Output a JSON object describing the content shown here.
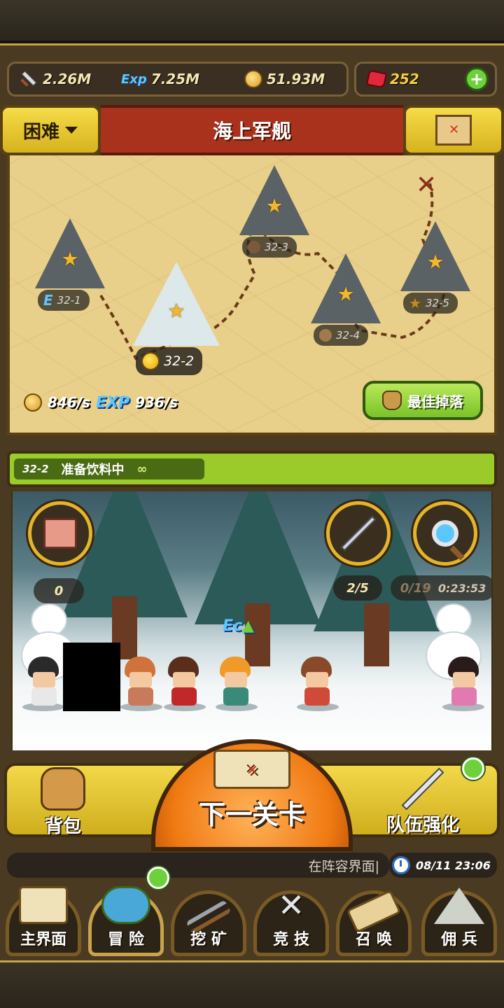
{
  "resources": {
    "attack": "2.26M",
    "exp_icon": "Exp",
    "exp": "7.25M",
    "gold": "51.93M",
    "gems": "252",
    "plus": "+"
  },
  "header": {
    "difficulty": "困难",
    "stage_name": "海上军舰"
  },
  "map": {
    "nodes": [
      {
        "id": "32-1",
        "badge": "E"
      },
      {
        "id": "32-2"
      },
      {
        "id": "32-3"
      },
      {
        "id": "32-4"
      },
      {
        "id": "32-5"
      }
    ],
    "gold_rate": "846/s",
    "exp_label": "EXP",
    "exp_rate": "936/s",
    "best_drop_label": "最佳掉落"
  },
  "status": {
    "stage": "32-2",
    "text": "准备饮料中",
    "repeat": "∞"
  },
  "battle": {
    "scroll_count": "0",
    "fight_count": "2/5",
    "search_count": "0/19",
    "search_timer": "0:23:53",
    "ec_label": "Ec"
  },
  "actions": {
    "backpack": "背包",
    "next_stage": "下一关卡",
    "team_upgrade": "队伍强化"
  },
  "ticker": {
    "message": "在阵容界面|",
    "datetime": "08/11 23:06"
  },
  "nav": [
    {
      "label": "主界面",
      "icon": "map-scroll-icon"
    },
    {
      "label": "冒 险",
      "icon": "island-icon"
    },
    {
      "label": "挖 矿",
      "icon": "pickaxe-icon"
    },
    {
      "label": "竞 技",
      "icon": "crossed-swords-icon"
    },
    {
      "label": "召 唤",
      "icon": "summon-scroll-icon"
    },
    {
      "label": "佣 兵",
      "icon": "tent-icon"
    }
  ],
  "colors": {
    "accent_yellow": "#f3d84a",
    "title_red": "#a8321c",
    "status_green": "#9acb2a",
    "next_orange": "#f07a12"
  }
}
